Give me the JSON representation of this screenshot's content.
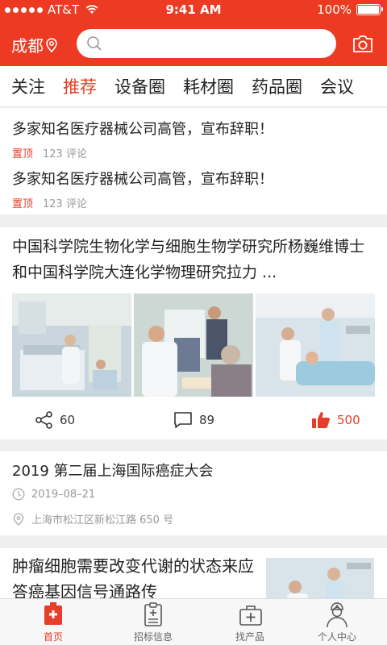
{
  "status": {
    "carrier": "AT&T",
    "time": "9:41 AM",
    "battery": "100%"
  },
  "header": {
    "city": "成都",
    "search_placeholder": ""
  },
  "tabs": [
    {
      "label": "关注",
      "active": false
    },
    {
      "label": "推荐",
      "active": true
    },
    {
      "label": "设备圈",
      "active": false
    },
    {
      "label": "耗材圈",
      "active": false
    },
    {
      "label": "药品圈",
      "active": false
    },
    {
      "label": "会议",
      "active": false
    }
  ],
  "pinned": [
    {
      "title": "多家知名医疗器械公司高管，宣布辞职！",
      "tag": "置顶",
      "comments": "123 评论"
    },
    {
      "title": "多家知名医疗器械公司高管，宣布辞职！",
      "tag": "置顶",
      "comments": "123 评论"
    }
  ],
  "feature": {
    "title": "中国科学院生物化学与细胞生物学研究所杨巍维博士和中国科学院大连化学物理研究拉力 ...",
    "shares": "60",
    "comments": "89",
    "likes": "500"
  },
  "event": {
    "title": "2019 第二届上海国际癌症大会",
    "date": "2019–08–21",
    "location": "上海市松江区新松江路 650 号"
  },
  "article": {
    "title": "肿瘤细胞需要改变代谢的状态来应答癌基因信号通路传"
  },
  "bottom_nav": [
    {
      "label": "首页",
      "icon": "home-icon",
      "active": true
    },
    {
      "label": "招标信息",
      "icon": "clipboard-icon",
      "active": false
    },
    {
      "label": "找产品",
      "icon": "medkit-icon",
      "active": false
    },
    {
      "label": "个人中心",
      "icon": "user-icon",
      "active": false
    }
  ],
  "colors": {
    "accent": "#ec3b22",
    "text": "#222222",
    "muted": "#999999"
  }
}
